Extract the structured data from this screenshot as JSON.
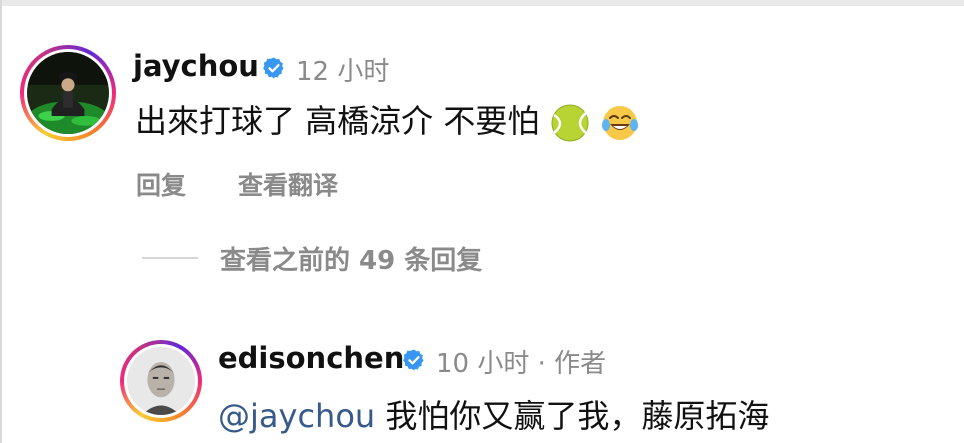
{
  "comments": [
    {
      "username": "jaychou",
      "time": "12 小时",
      "text": "出來打球了 高橋涼介 不要怕",
      "emojis": [
        "tennis-ball-icon",
        "tears-of-joy-icon"
      ],
      "actions": {
        "reply": "回复",
        "translate": "查看翻译"
      }
    }
  ],
  "view_previous_replies": "查看之前的 49 条回复",
  "reply": {
    "username": "edisonchen",
    "time": "10 小时 · 作者",
    "mention": "@jaychou",
    "text": "我怕你又赢了我，藤原拓海"
  },
  "colors": {
    "verified": "#3897f0",
    "secondary_text": "#8a8a8a",
    "mention": "#375a8a"
  }
}
